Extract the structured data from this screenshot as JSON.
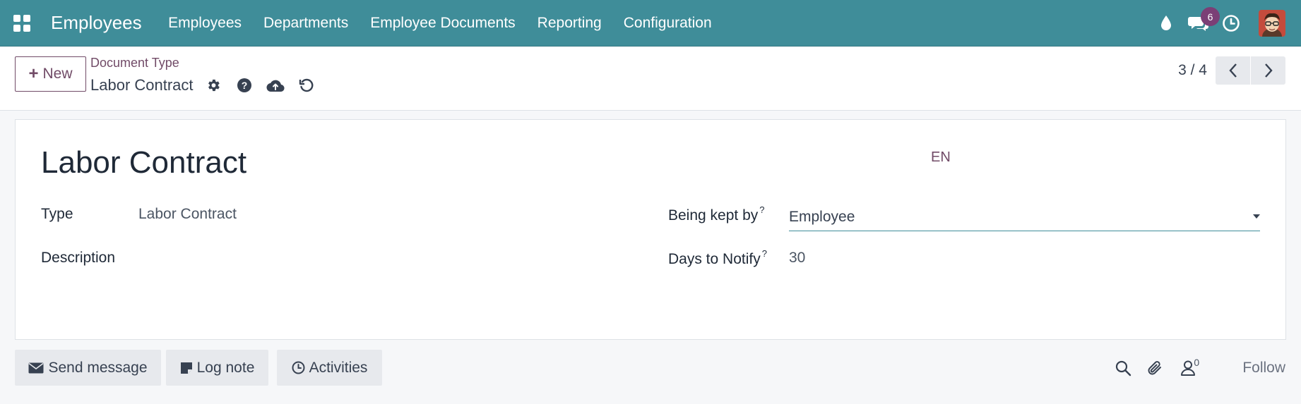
{
  "navbar": {
    "brand": "Employees",
    "items": [
      "Employees",
      "Departments",
      "Employee Documents",
      "Reporting",
      "Configuration"
    ],
    "icons": [
      "apps-icon",
      "drop-icon",
      "chat-bubbles-icon",
      "clock-icon",
      "avatar"
    ],
    "message_badge": "6",
    "color": "#3f8d99"
  },
  "control_panel": {
    "new_label": "New",
    "breadcrumb": "Document Type",
    "record_name": "Labor Contract",
    "actions": [
      "gear-icon",
      "help-icon",
      "cloud-upload-icon",
      "undo-icon"
    ],
    "pager": "3 / 4"
  },
  "form": {
    "title": "Labor Contract",
    "language": "EN",
    "type_label": "Type",
    "type_value": "Labor Contract",
    "description_label": "Description",
    "description_value": "",
    "kept_by_label": "Being kept by",
    "kept_by_value": "Employee",
    "notify_label": "Days to Notify",
    "notify_value": "30",
    "help_marker": "?"
  },
  "chatter": {
    "send_message": "Send message",
    "log_note": "Log note",
    "activities": "Activities",
    "followers_count": "0",
    "follow": "Follow"
  },
  "colors": {
    "accent": "#714b67",
    "navbar": "#3f8d99",
    "badge": "#7b3f76"
  }
}
